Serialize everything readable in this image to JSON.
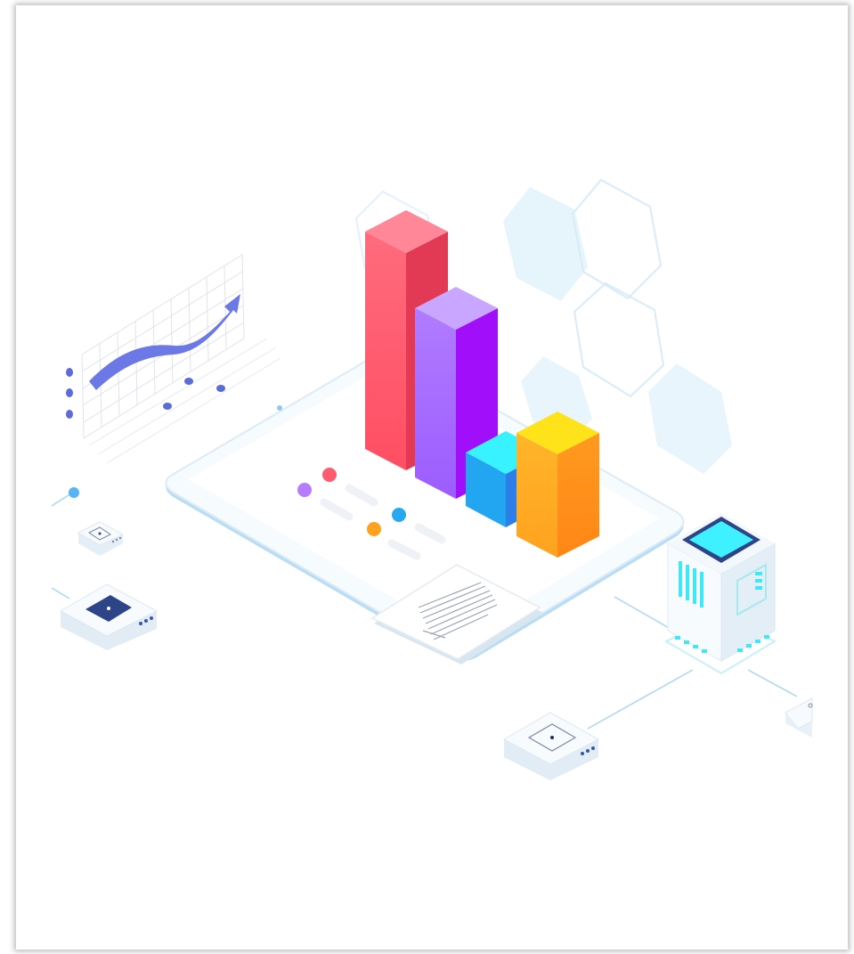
{
  "illustration": {
    "subject": "isometric-data-analytics",
    "palette": {
      "bar_red": "#ff5b6e",
      "bar_purple": "#a96bff",
      "bar_cyan": "#28d4ff",
      "bar_orange": "#ffa21f",
      "trend_arrow": "#6b78e6",
      "server_screen": "#3ff0ff",
      "device_chip": "#2e4488",
      "hexagon": "#e6f4fb",
      "tablet_edge": "#cfe6f7"
    },
    "icons": [
      "trend-arrow-icon",
      "bar-chart-icon",
      "document-icon",
      "server-icon",
      "network-node-icon"
    ]
  }
}
